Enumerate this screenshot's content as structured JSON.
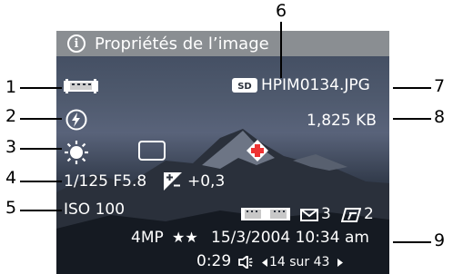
{
  "title": "Propriétés de l’image",
  "filename": "HPIM0134.JPG",
  "sd_badge": "SD",
  "file_size": "1,825 KB",
  "exposure": "1/125 F5.8",
  "exposure_comp": "+0,3",
  "iso": "ISO 100",
  "email_count": "3",
  "print_count": "2",
  "resolution": "4MP",
  "rating": "★★",
  "datetime": "15/3/2004 10:34 am",
  "duration": "0:29",
  "position": "14 sur 43",
  "callouts": [
    "1",
    "2",
    "3",
    "4",
    "5",
    "6",
    "7",
    "8",
    "9"
  ],
  "colors": {
    "title_bar": "#8a8e92",
    "text": "#ffffff",
    "callout": "#000000"
  },
  "icons": {
    "panorama": "panorama-icon",
    "flash": "flash-off-icon",
    "white_balance": "sun-icon",
    "display": "blank-frame-icon",
    "focus": "focus-icon",
    "exposure_comp": "exposure-compensation-icon",
    "email": "envelope-icon",
    "print": "printer-icon",
    "audio": "speaker-icon"
  }
}
